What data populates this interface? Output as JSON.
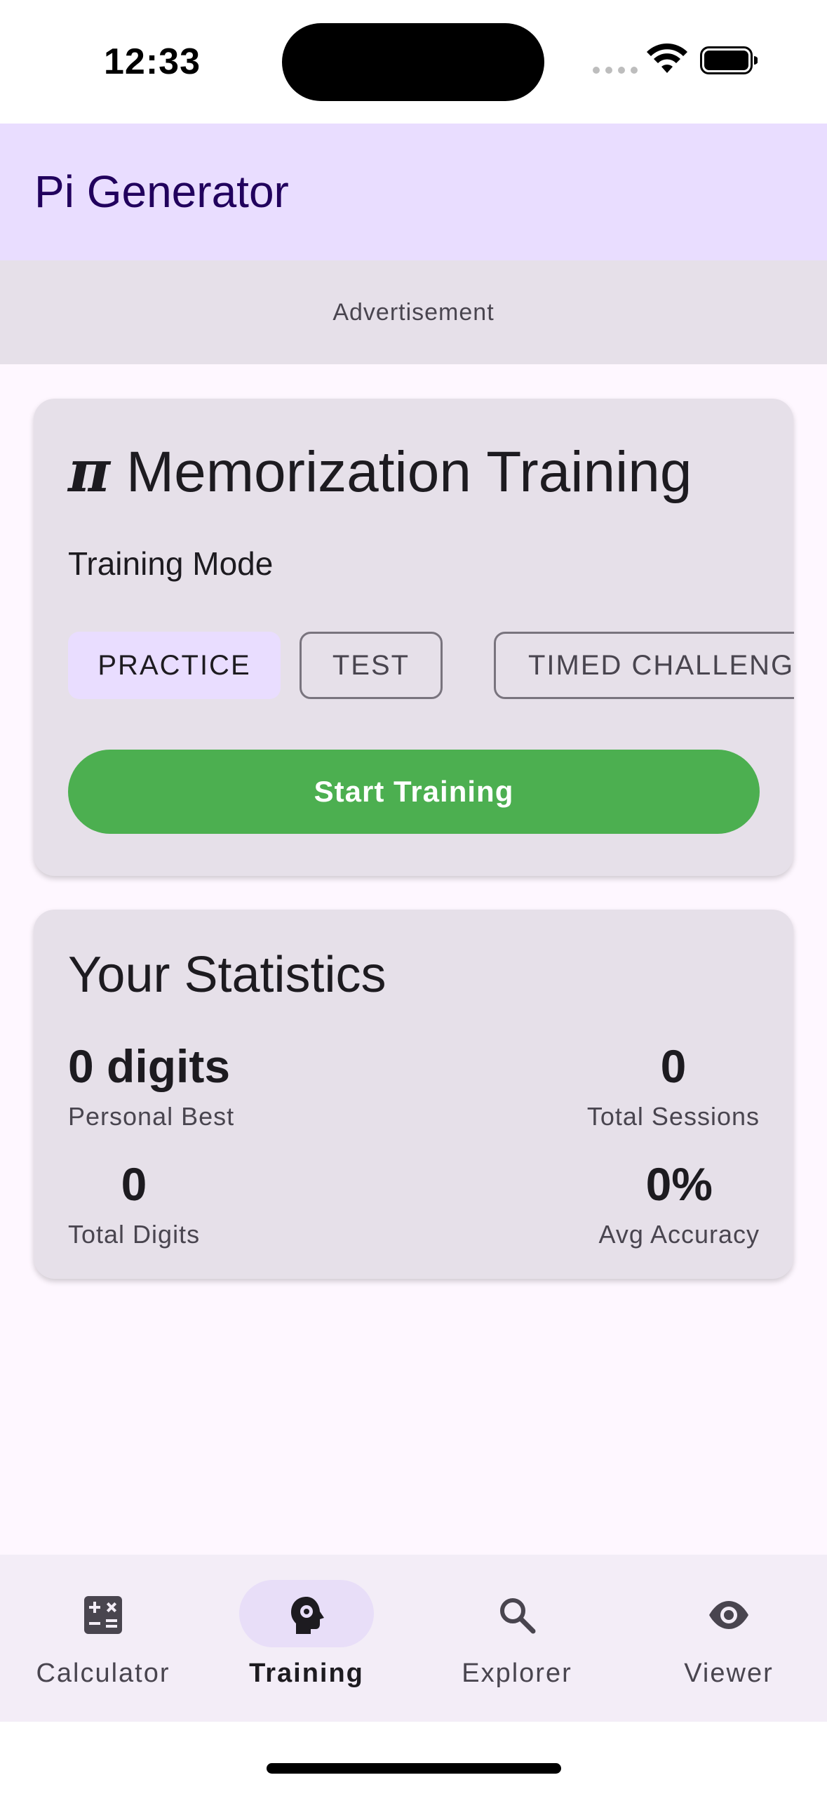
{
  "status_bar": {
    "time": "12:33"
  },
  "app_bar": {
    "title": "Pi Generator"
  },
  "ad": {
    "label": "Advertisement"
  },
  "training_card": {
    "pi_symbol": "π",
    "title": "Memorization Training",
    "mode_label": "Training Mode",
    "modes": [
      {
        "label": "PRACTICE",
        "selected": true
      },
      {
        "label": "TEST",
        "selected": false
      },
      {
        "label": "TIMED CHALLENG",
        "selected": false
      }
    ],
    "start_button": "Start Training"
  },
  "stats_card": {
    "title": "Your Statistics",
    "personal_best": {
      "value": "0 digits",
      "label": "Personal Best"
    },
    "total_sessions": {
      "value": "0",
      "label": "Total Sessions"
    },
    "total_digits": {
      "value": "0",
      "label": "Total Digits"
    },
    "avg_accuracy": {
      "value": "0%",
      "label": "Avg Accuracy"
    }
  },
  "bottom_nav": {
    "items": [
      {
        "label": "Calculator",
        "icon": "calculator-icon",
        "active": false
      },
      {
        "label": "Training",
        "icon": "brain-gear-icon",
        "active": true
      },
      {
        "label": "Explorer",
        "icon": "search-icon",
        "active": false
      },
      {
        "label": "Viewer",
        "icon": "eye-icon",
        "active": false
      }
    ]
  },
  "colors": {
    "app_bar": "#e9ddff",
    "start_button": "#4caf50",
    "card": "#e6e0e9",
    "title_text": "#21005d"
  }
}
